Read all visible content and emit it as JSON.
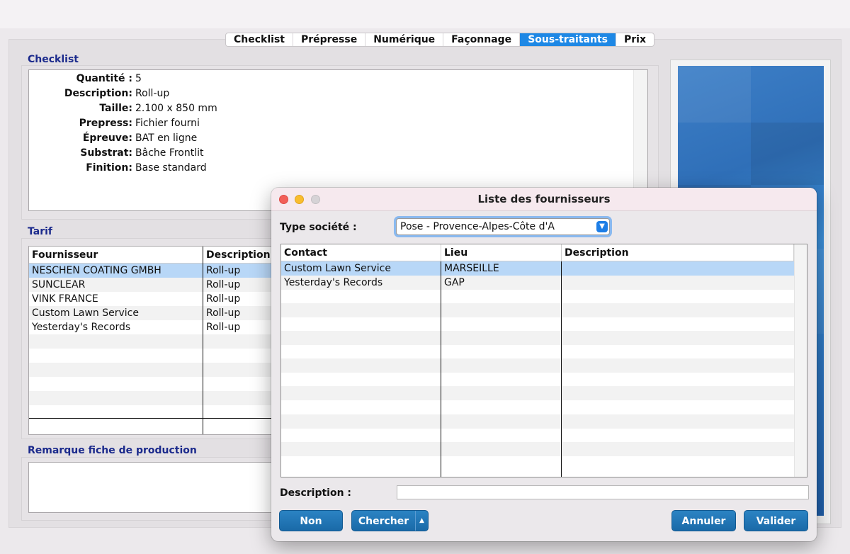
{
  "tabs": [
    {
      "label": "Checklist",
      "active": false
    },
    {
      "label": "Prépresse",
      "active": false
    },
    {
      "label": "Numérique",
      "active": false
    },
    {
      "label": "Façonnage",
      "active": false
    },
    {
      "label": "Sous-traitants",
      "active": true
    },
    {
      "label": "Prix",
      "active": false
    }
  ],
  "checklist": {
    "title": "Checklist",
    "rows": [
      {
        "label": "Quantité :",
        "value": "5"
      },
      {
        "label": "Description:",
        "value": "Roll-up"
      },
      {
        "label": "Taille:",
        "value": "2.100 x 850 mm"
      },
      {
        "label": "Prepress:",
        "value": "Fichier fourni"
      },
      {
        "label": "Épreuve:",
        "value": "BAT en ligne"
      },
      {
        "label": "Substrat:",
        "value": "Bâche Frontlit"
      },
      {
        "label": "Finition:",
        "value": "Base standard"
      }
    ]
  },
  "tarif": {
    "title": "Tarif",
    "columns": [
      "Fournisseur",
      "Description"
    ],
    "rows": [
      {
        "fournisseur": "NESCHEN COATING GMBH",
        "description": "Roll-up",
        "selected": true
      },
      {
        "fournisseur": "SUNCLEAR",
        "description": "Roll-up",
        "selected": false
      },
      {
        "fournisseur": "VINK FRANCE",
        "description": "Roll-up",
        "selected": false
      },
      {
        "fournisseur": "Custom Lawn Service",
        "description": "Roll-up",
        "selected": false
      },
      {
        "fournisseur": "Yesterday's Records",
        "description": "Roll-up",
        "selected": false
      }
    ]
  },
  "remarque": {
    "title": "Remarque fiche de production"
  },
  "dialog": {
    "title": "Liste des fournisseurs",
    "type_label": "Type société :",
    "type_value": "Pose - Provence-Alpes-Côte d'A",
    "columns": [
      "Contact",
      "Lieu",
      "Description"
    ],
    "rows": [
      {
        "contact": "Custom Lawn Service",
        "lieu": "MARSEILLE",
        "description": "",
        "selected": true
      },
      {
        "contact": "Yesterday's Records",
        "lieu": "GAP",
        "description": "",
        "selected": false
      }
    ],
    "description_label": "Description :",
    "description_value": "",
    "buttons": {
      "non": "Non",
      "chercher": "Chercher",
      "annuler": "Annuler",
      "valider": "Valider"
    }
  },
  "colors": {
    "accent": "#1e88e5",
    "section_title": "#1b2a8c",
    "selection": "#b8d7f7",
    "button": "#1a6aa8"
  }
}
